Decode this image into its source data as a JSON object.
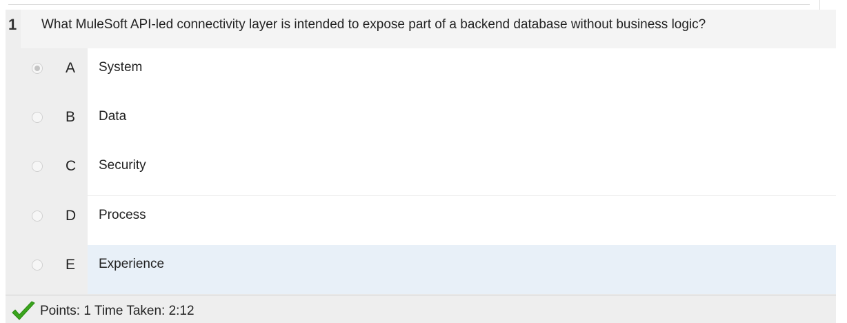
{
  "question": {
    "number": "1",
    "text": "What MuleSoft API-led connectivity layer is intended to expose part of a backend database without business logic?"
  },
  "options": [
    {
      "letter": "A",
      "text": "System",
      "selected": true
    },
    {
      "letter": "B",
      "text": "Data",
      "selected": false
    },
    {
      "letter": "C",
      "text": "Security",
      "selected": false
    },
    {
      "letter": "D",
      "text": "Process",
      "selected": false
    },
    {
      "letter": "E",
      "text": "Experience",
      "selected": false
    }
  ],
  "footer": {
    "result_icon": "check-icon",
    "result_color": "#3aa51d",
    "text": "Points: 1 Time Taken: 2:12"
  },
  "colors": {
    "highlight_row": "#e8f0f8",
    "panel_background": "#eeeeee"
  }
}
